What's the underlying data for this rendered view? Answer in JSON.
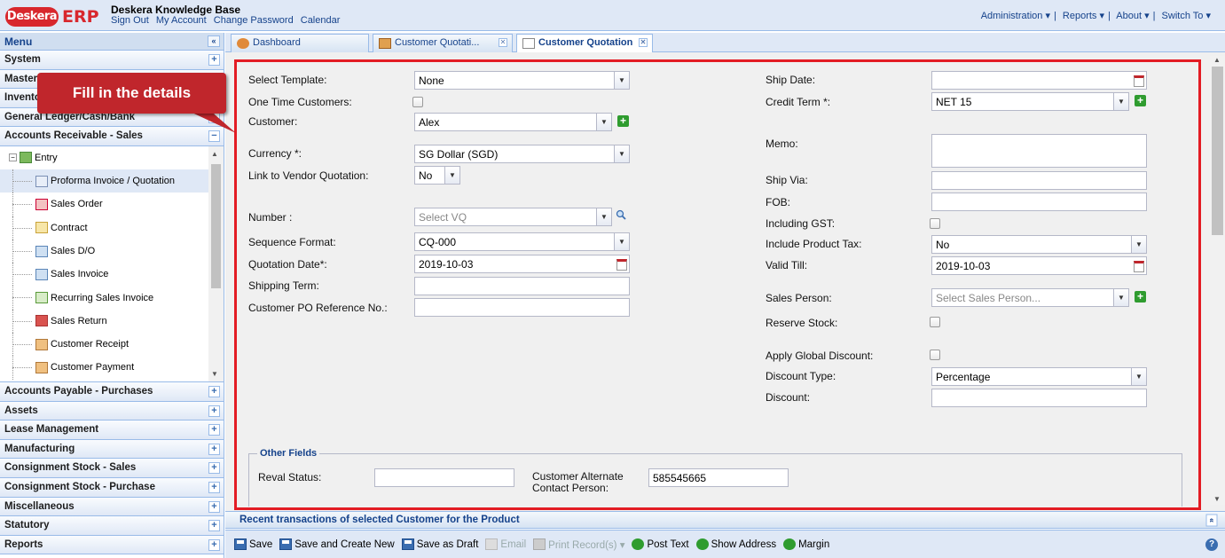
{
  "header": {
    "logo_brand": "Deskera",
    "logo_suffix": "ERP",
    "app_title": "Deskera Knowledge Base",
    "links": [
      "Sign Out",
      "My Account",
      "Change Password",
      "Calendar"
    ],
    "right_links": [
      "Administration ▾",
      "Reports ▾",
      "About ▾",
      "Switch To ▾"
    ]
  },
  "sidebar": {
    "title": "Menu",
    "collapse_glyph": "«",
    "sections_top": [
      {
        "label": "System",
        "toggle": "+"
      },
      {
        "label": "Masters",
        "toggle": "+"
      },
      {
        "label": "Inventory",
        "toggle": "+"
      },
      {
        "label": "General Ledger/Cash/Bank",
        "toggle": "+"
      },
      {
        "label": "Accounts Receivable - Sales",
        "toggle": "−"
      }
    ],
    "tree_root": "Entry",
    "tree_items": [
      {
        "label": "Proforma Invoice / Quotation",
        "icon": "proforma-icon",
        "selected": true
      },
      {
        "label": "Sales Order",
        "icon": "sales-order-icon",
        "selected": false
      },
      {
        "label": "Contract",
        "icon": "contract-icon",
        "selected": false
      },
      {
        "label": "Sales D/O",
        "icon": "delivery-order-icon",
        "selected": false
      },
      {
        "label": "Sales Invoice",
        "icon": "sales-invoice-icon",
        "selected": false
      },
      {
        "label": "Recurring Sales Invoice",
        "icon": "recurring-invoice-icon",
        "selected": false
      },
      {
        "label": "Sales Return",
        "icon": "sales-return-icon",
        "selected": false
      },
      {
        "label": "Customer Receipt",
        "icon": "customer-receipt-icon",
        "selected": false
      },
      {
        "label": "Customer Payment",
        "icon": "customer-payment-icon",
        "selected": false
      }
    ],
    "sections_bottom": [
      {
        "label": "Accounts Payable - Purchases",
        "toggle": "+"
      },
      {
        "label": "Assets",
        "toggle": "+"
      },
      {
        "label": "Lease Management",
        "toggle": "+"
      },
      {
        "label": "Manufacturing",
        "toggle": "+"
      },
      {
        "label": "Consignment Stock - Sales",
        "toggle": "+"
      },
      {
        "label": "Consignment Stock - Purchase",
        "toggle": "+"
      },
      {
        "label": "Miscellaneous",
        "toggle": "+"
      },
      {
        "label": "Statutory",
        "toggle": "+"
      },
      {
        "label": "Reports",
        "toggle": "+"
      }
    ]
  },
  "callout": {
    "text": "Fill in the details",
    "color": "#c0262c"
  },
  "tabs": [
    {
      "label": "Dashboard",
      "closable": false,
      "active": false
    },
    {
      "label": "Customer Quotati...",
      "closable": true,
      "active": false
    },
    {
      "label": "Customer Quotation",
      "closable": true,
      "active": true
    }
  ],
  "form": {
    "left": {
      "select_template": {
        "label": "Select Template:",
        "value": "None"
      },
      "one_time_customers": {
        "label": "One Time Customers:",
        "checked": false
      },
      "customer": {
        "label": "Customer:",
        "value": "Alex"
      },
      "currency": {
        "label": "Currency *:",
        "value": "SG Dollar (SGD)"
      },
      "link_vendor_quotation": {
        "label": "Link to Vendor Quotation:",
        "value": "No"
      },
      "number": {
        "label": "Number :",
        "placeholder": "Select VQ"
      },
      "sequence_format": {
        "label": "Sequence Format:",
        "value": "CQ-000"
      },
      "quotation_date": {
        "label": "Quotation Date*:",
        "value": "2019-10-03"
      },
      "shipping_term": {
        "label": "Shipping Term:",
        "value": ""
      },
      "customer_po_ref": {
        "label": "Customer PO Reference No.:",
        "value": ""
      }
    },
    "right": {
      "ship_date": {
        "label": "Ship Date:",
        "value": ""
      },
      "credit_term": {
        "label": "Credit Term *:",
        "value": "NET 15"
      },
      "memo": {
        "label": "Memo:",
        "value": ""
      },
      "ship_via": {
        "label": "Ship Via:",
        "value": ""
      },
      "fob": {
        "label": "FOB:",
        "value": ""
      },
      "including_gst": {
        "label": "Including GST:",
        "checked": false
      },
      "include_product_tax": {
        "label": "Include Product Tax:",
        "value": "No"
      },
      "valid_till": {
        "label": "Valid Till:",
        "value": "2019-10-03"
      },
      "sales_person": {
        "label": "Sales Person:",
        "placeholder": "Select Sales Person..."
      },
      "reserve_stock": {
        "label": "Reserve Stock:",
        "checked": false
      },
      "apply_global_discount": {
        "label": "Apply Global Discount:",
        "checked": false
      },
      "discount_type": {
        "label": "Discount Type:",
        "value": "Percentage"
      },
      "discount": {
        "label": "Discount:",
        "value": ""
      }
    },
    "other_fields": {
      "legend": "Other Fields",
      "reval_status": {
        "label": "Reval Status:",
        "value": ""
      },
      "customer_alt_contact": {
        "label_line1": "Customer Alternate",
        "label_line2": "Contact Person:",
        "value": "585545665"
      }
    }
  },
  "recent_bar": {
    "label": "Recent transactions of selected Customer for the Product",
    "expand_glyph": "«"
  },
  "toolbar": {
    "save": "Save",
    "save_create_new": "Save and Create New",
    "save_draft": "Save as Draft",
    "email": "Email",
    "print_records": "Print Record(s) ▾",
    "post_text": "Post Text",
    "show_address": "Show Address",
    "margin": "Margin",
    "help_glyph": "?"
  },
  "colors": {
    "accent": "#15428b",
    "highlight_border": "#e31c24",
    "brand": "#d8272d"
  }
}
